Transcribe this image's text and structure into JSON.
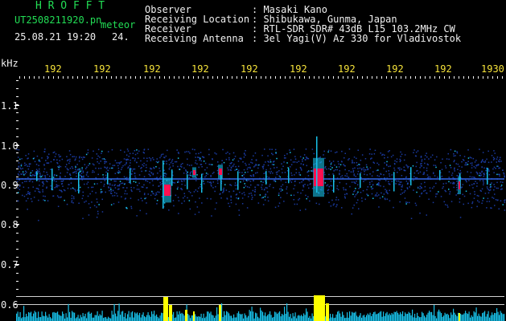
{
  "header": {
    "program": "H R O F F T",
    "filename": "UT2508211920.pn",
    "meteor_tag": "meteor",
    "date_time": "25.08.21 19:20",
    "count": "24.",
    "fields": [
      {
        "label": "Observer",
        "value": ": Masaki Kano"
      },
      {
        "label": "Receiving Location",
        "value": ": Shibukawa, Gunma, Japan"
      },
      {
        "label": "Receiver",
        "value": ": RTL-SDR SDR# 43dB L15 103.2MHz CW"
      },
      {
        "label": "Receiving Antenna",
        "value": ": 3el Yagi(V) Az 330 for Vladivostok"
      }
    ]
  },
  "axis": {
    "unit": "kHz",
    "y_ticks": [
      "1.1",
      "1.0",
      "0.9",
      "0.8",
      "0.7",
      "0.6"
    ],
    "x_ticks": [
      "192",
      "192",
      "192",
      "192",
      "192",
      "192",
      "192",
      "192",
      "192",
      "1930"
    ]
  },
  "colors": {
    "background": "#000000",
    "header_green": "#22dd55",
    "text_white": "#f0f0f0",
    "tick_yellow": "#f5e23a",
    "noise_blue": "#1a3aa0",
    "signal_cyan": "#18c0e8",
    "signal_red": "#ff1050",
    "amplitude_yellow": "#ffff00"
  }
}
